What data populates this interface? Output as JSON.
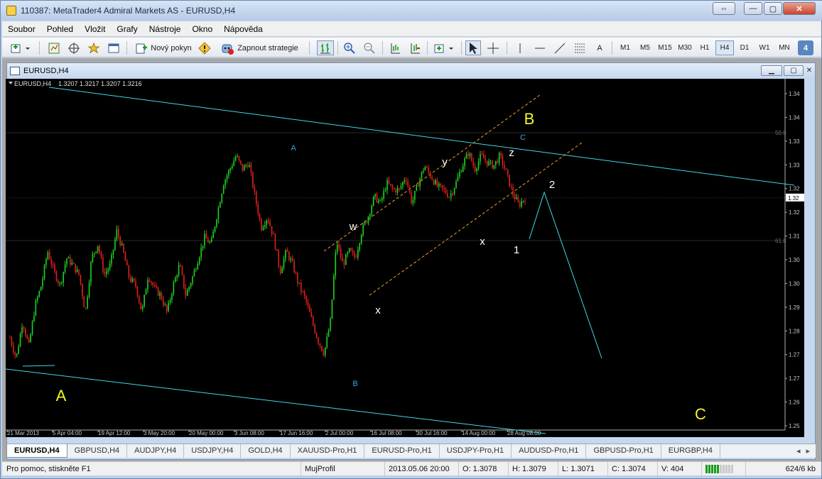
{
  "window": {
    "title": "110387: MetaTrader4 Admiral Markets AS - EURUSD,H4",
    "btn_restore_wide": "⇔",
    "btn_min": "—",
    "btn_max": "▢",
    "btn_close": "✕"
  },
  "menu": [
    "Soubor",
    "Pohled",
    "Vložit",
    "Grafy",
    "Nástroje",
    "Okno",
    "Nápověda"
  ],
  "toolbar": {
    "new_order": "Nový pokyn",
    "autotrading": "Zapnout strategie",
    "text_tool": "A",
    "timeframes": [
      "M1",
      "M5",
      "M15",
      "M30",
      "H1",
      "H4",
      "D1",
      "W1",
      "MN"
    ],
    "active_timeframe": "H4",
    "badge": "4"
  },
  "chart_window": {
    "title": "EURUSD,H4"
  },
  "chart_data": {
    "type": "candlestick",
    "symbol_label": "EURUSD,H4",
    "ohlc_label": "1.3207 1.3217 1.3207 1.3216",
    "background": "#000000",
    "bull_color": "#1fd41f",
    "bear_color": "#e02020",
    "channel_color": "#3fd8e8",
    "fork_color": "#f0a020",
    "price_axis": {
      "labels": [
        "1.34",
        "1.34",
        "1.33",
        "1.33",
        "1.32",
        "1.32",
        "1.31",
        "1.30",
        "1.30",
        "1.29",
        "1.28",
        "1.27",
        "1.27",
        "1.26",
        "1.25"
      ],
      "current": "1.32",
      "fib_labels": [
        "50.0",
        "61.8"
      ]
    },
    "time_axis": [
      "21 Mar 2013",
      "5 Apr 04:00",
      "19 Apr 12:00",
      "3 May 20:00",
      "20 May 00:00",
      "3 Jun 08:00",
      "17 Jun 16:00",
      "2 Jul 00:00",
      "16 Jul 08:00",
      "30 Jul 16:00",
      "14 Aug 00:00",
      "28 Aug 08:00"
    ],
    "wave_labels": {
      "big_A": "A",
      "big_B": "B",
      "big_C": "C",
      "small_A": "A",
      "small_B": "B",
      "small_C": "C",
      "w": "w",
      "x1": "x",
      "y": "y",
      "x2": "x",
      "z": "z",
      "one": "1",
      "two": "2"
    },
    "close_path": [
      1.2806,
      1.2745,
      1.2855,
      1.278,
      1.29,
      1.296,
      1.306,
      1.3,
      1.296,
      1.304,
      1.302,
      1.299,
      1.288,
      1.304,
      1.308,
      1.299,
      1.302,
      1.312,
      1.306,
      1.298,
      1.296,
      1.288,
      1.299,
      1.295,
      1.293,
      1.288,
      1.296,
      1.302,
      1.293,
      1.298,
      1.304,
      1.31,
      1.308,
      1.317,
      1.326,
      1.33,
      1.334,
      1.33,
      1.332,
      1.322,
      1.313,
      1.316,
      1.31,
      1.3,
      1.306,
      1.302,
      1.296,
      1.292,
      1.286,
      1.28,
      1.276,
      1.285,
      1.309,
      1.302,
      1.306,
      1.304,
      1.312,
      1.316,
      1.322,
      1.32,
      1.326,
      1.324,
      1.324,
      1.328,
      1.32,
      1.326,
      1.331,
      1.328,
      1.325,
      1.324,
      1.322,
      1.326,
      1.331,
      1.335,
      1.33,
      1.334,
      1.332,
      1.331,
      1.334,
      1.329,
      1.323,
      1.3195,
      1.3216
    ]
  },
  "tabs": [
    "EURUSD,H4",
    "GBPUSD,H4",
    "AUDJPY,H4",
    "USDJPY,H4",
    "GOLD,H4",
    "XAUUSD-Pro,H1",
    "EURUSD-Pro,H1",
    "USDJPY-Pro,H1",
    "AUDUSD-Pro,H1",
    "GBPUSD-Pro,H1",
    "EURGBP,H4"
  ],
  "status": {
    "help": "Pro pomoc, stiskněte F1",
    "profile": "MujProfil",
    "datetime": "2013.05.06 20:00",
    "open": "O: 1.3078",
    "high": "H: 1.3079",
    "low": "L: 1.3071",
    "close": "C: 1.3074",
    "volume": "V: 404",
    "traffic": "624/6 kb"
  }
}
